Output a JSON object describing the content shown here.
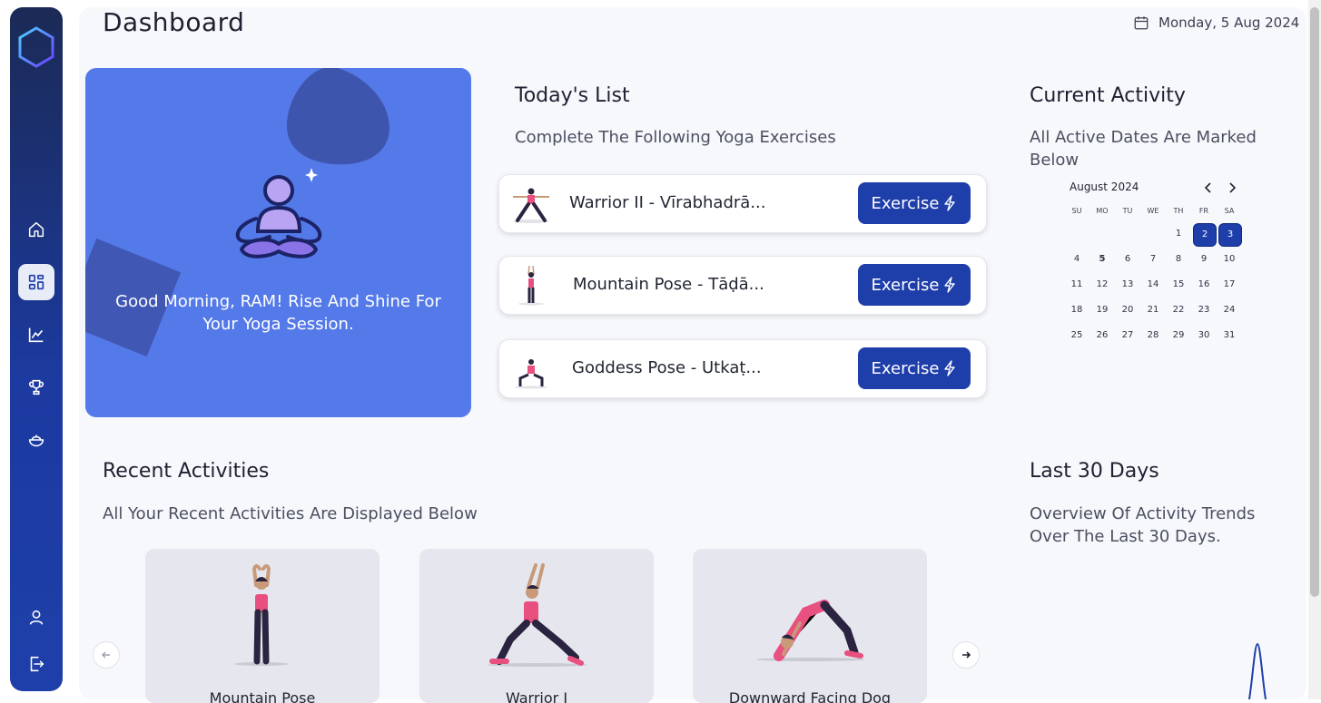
{
  "header": {
    "title": "Dashboard",
    "date": "Monday, 5 Aug 2024"
  },
  "sidebar": {
    "items": [
      {
        "name": "home",
        "icon": "home-icon"
      },
      {
        "name": "dashboard",
        "icon": "grid-icon",
        "active": true
      },
      {
        "name": "analytics",
        "icon": "chart-icon"
      },
      {
        "name": "achievements",
        "icon": "trophy-icon"
      },
      {
        "name": "diet",
        "icon": "bowl-icon"
      },
      {
        "name": "profile",
        "icon": "user-icon"
      },
      {
        "name": "logout",
        "icon": "logout-icon"
      }
    ]
  },
  "hero": {
    "greeting": "Good Morning, RAM! Rise And Shine For Your Yoga Session."
  },
  "todays_list": {
    "title": "Today's List",
    "subtitle": "Complete The Following Yoga Exercises",
    "items": [
      {
        "name": "Warrior II - Vīrabhadrā...",
        "button": "Exercise"
      },
      {
        "name": "Mountain Pose - Tāḍā...",
        "button": "Exercise"
      },
      {
        "name": "Goddess Pose - Utkaṭ...",
        "button": "Exercise"
      }
    ]
  },
  "current_activity": {
    "title": "Current Activity",
    "subtitle": "All Active Dates Are Marked Below",
    "calendar": {
      "month": "August 2024",
      "weekdays": [
        "SU",
        "MO",
        "TU",
        "WE",
        "TH",
        "FR",
        "SA"
      ],
      "first_weekday_index": 4,
      "days_in_month": 31,
      "marked_days": [
        2,
        3
      ],
      "today": 5
    }
  },
  "recent_activities": {
    "title": "Recent Activities",
    "subtitle": "All Your Recent Activities Are Displayed Below",
    "cards": [
      {
        "label": "Mountain Pose"
      },
      {
        "label": "Warrior I"
      },
      {
        "label": "Downward Facing Dog"
      }
    ]
  },
  "last_30_days": {
    "title": "Last 30 Days",
    "subtitle": "Overview Of Activity Trends Over The Last 30 Days."
  },
  "colors": {
    "sidebar": "#1c3aa0",
    "hero": "#5479e8",
    "button": "#1e3eaa",
    "background": "#f7f8fc"
  }
}
